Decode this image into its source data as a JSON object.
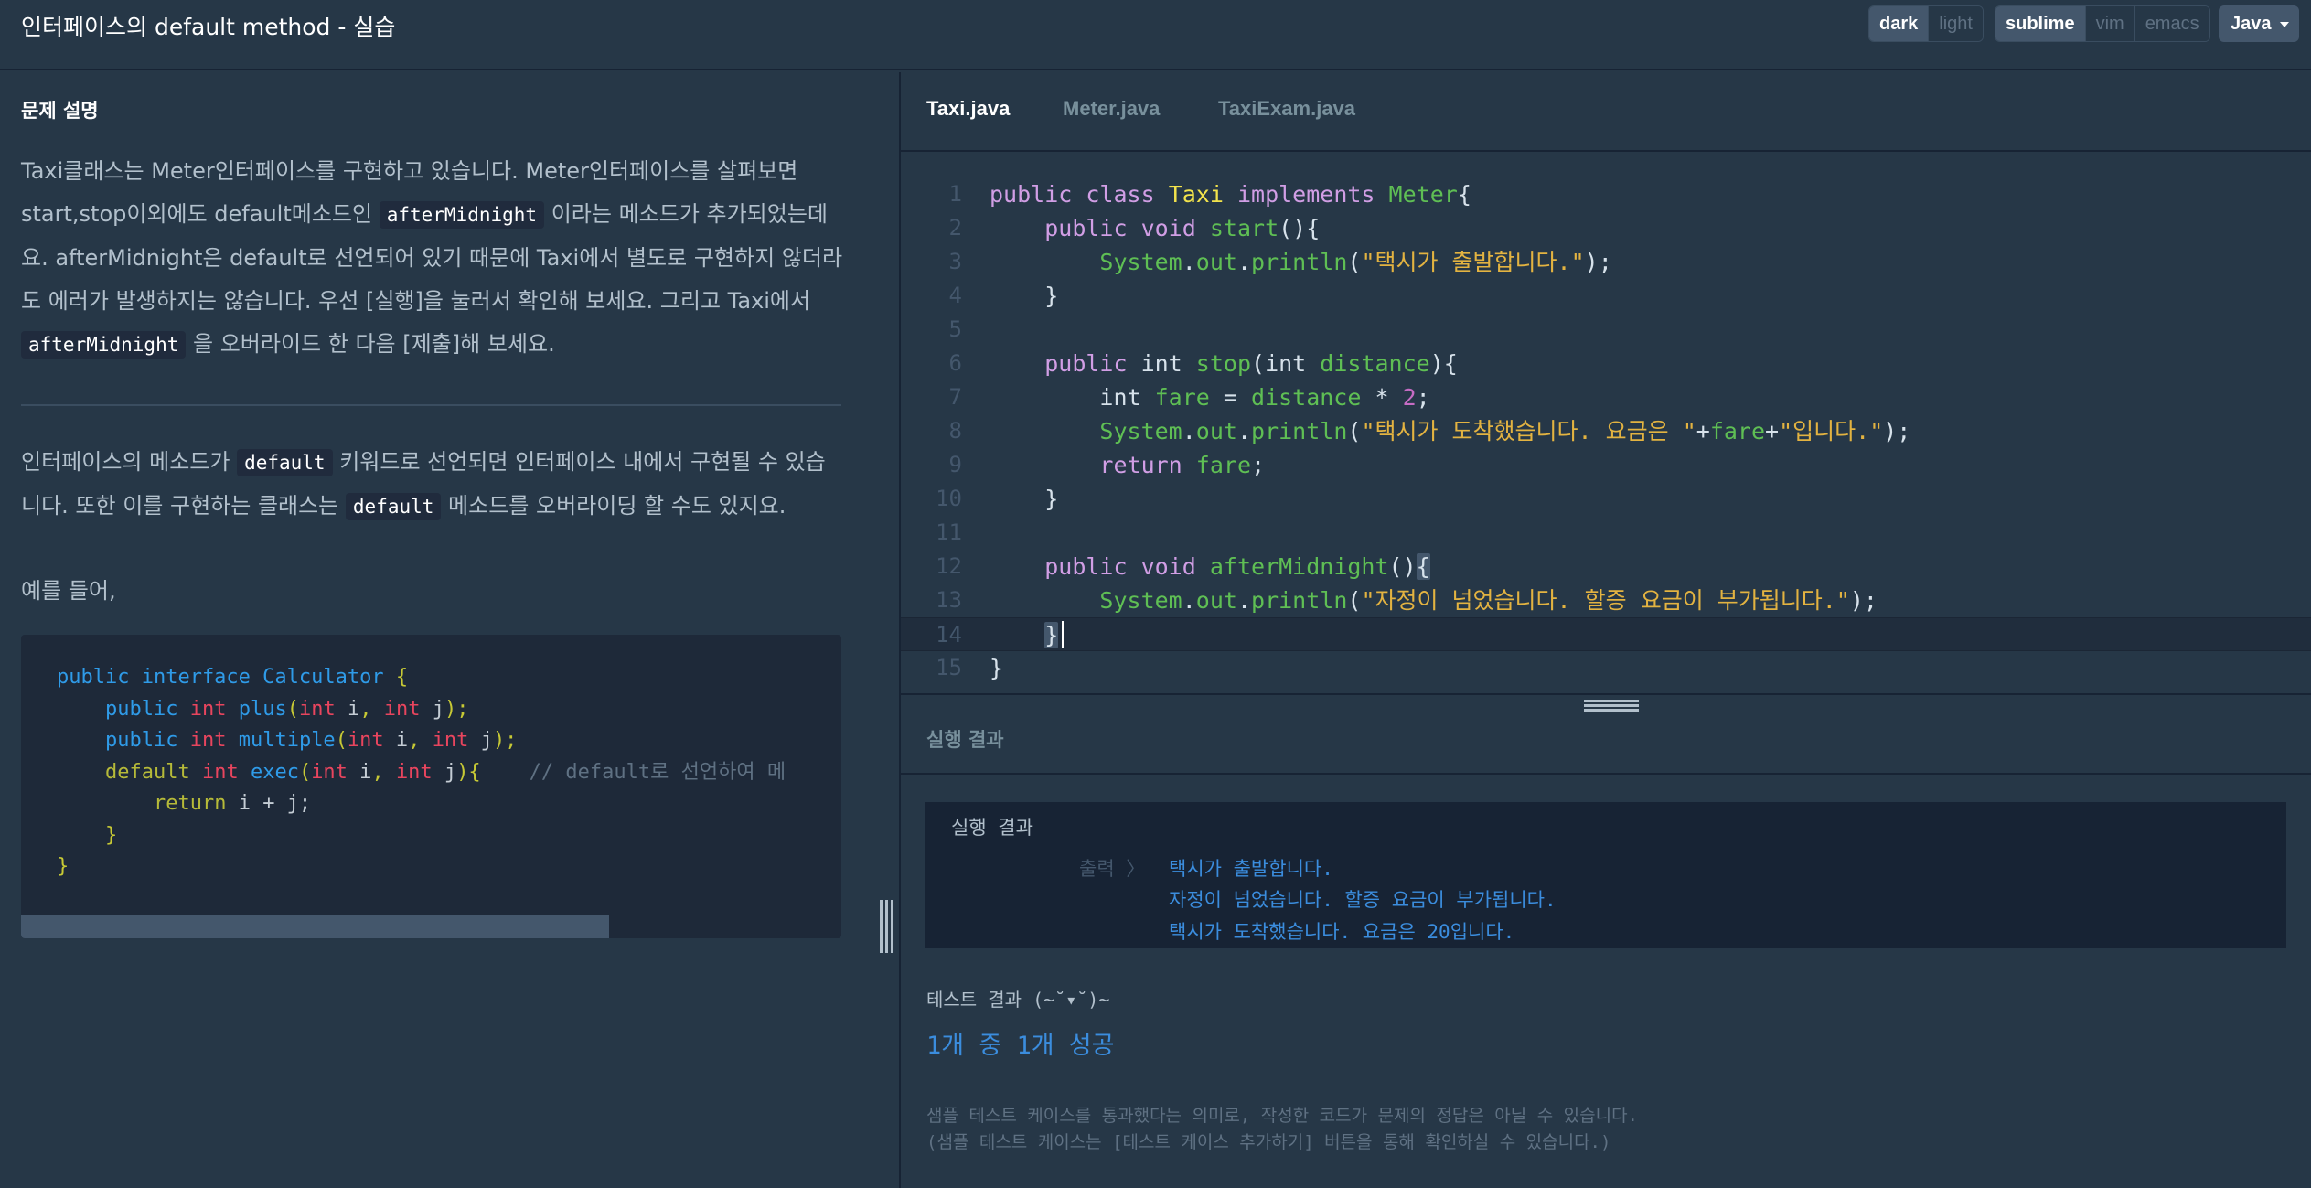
{
  "header": {
    "title": "인터페이스의 default method - 실습",
    "theme_dark": "dark",
    "theme_light": "light",
    "keymap_sublime": "sublime",
    "keymap_vim": "vim",
    "keymap_emacs": "emacs",
    "language": "Java"
  },
  "problem": {
    "section_title": "문제 설명",
    "p1_a": "Taxi클래스는 Meter인터페이스를 구현하고 있습니다. Meter인터페이스를 살펴보면 start,stop이외에도 default메소드인 ",
    "p1_code1": "afterMidnight",
    "p1_b": " 이라는 메소드가 추가되었는데요. afterMidnight은 default로 선언되어 있기 때문에 Taxi에서 별도로 구현하지 않더라도 에러가 발생하지는 않습니다. 우선 [실행]을 눌러서 확인해 보세요. 그리고 Taxi에서 ",
    "p1_code2": "afterMidnight",
    "p1_c": " 을 오버라이드 한 다음 [제출]해 보세요.",
    "p2_a": "인터페이스의 메소드가 ",
    "p2_code1": "default",
    "p2_b": " 키워드로 선언되면 인터페이스 내에서 구현될 수 있습니다. 또한 이를 구현하는 클래스는 ",
    "p2_code2": "default",
    "p2_c": " 메소드를 오버라이딩 할 수도 있지요.",
    "p3": "예를 들어,",
    "example": {
      "l1_kw": "public interface",
      "l1_name": "Calculator",
      "l1_brace": "{",
      "l2": "public",
      "l2_type": "int",
      "l2_name": "plus",
      "l3_name": "multiple",
      "l4_default": "default",
      "l4_name": "exec",
      "l4_comment": "// default로 선언하여 메",
      "l5_return": "return",
      "l5_expr": "i + j;",
      "l6": "}",
      "l7": "}"
    }
  },
  "editor": {
    "tabs": [
      "Taxi.java",
      "Meter.java",
      "TaxiExam.java"
    ],
    "line_numbers": [
      "1",
      "2",
      "3",
      "4",
      "5",
      "6",
      "7",
      "8",
      "9",
      "10",
      "11",
      "12",
      "13",
      "14",
      "15"
    ],
    "current_line": 14
  },
  "result": {
    "panel_title": "실행 결과",
    "box_title": "실행 결과",
    "output_label": "출력 〉",
    "output_lines": [
      "택시가 출발합니다.",
      "자정이 넘었습니다. 할증 요금이 부가됩니다.",
      "택시가 도착했습니다. 요금은 20입니다."
    ],
    "test_title": "테스트 결과 (~˘▾˘)~",
    "test_summary": "1개 중 1개 성공",
    "note1": "샘플 테스트 케이스를 통과했다는 의미로, 작성한 코드가 문제의 정답은 아닐 수 있습니다.",
    "note2": "(샘플 테스트 케이스는 [테스트 케이스 추가하기] 버튼을 통해 확인하실 수 있습니다.)"
  },
  "colors": {
    "background": "#263747",
    "accent_blue": "#3b8dde",
    "code_bg": "#1e2939"
  }
}
